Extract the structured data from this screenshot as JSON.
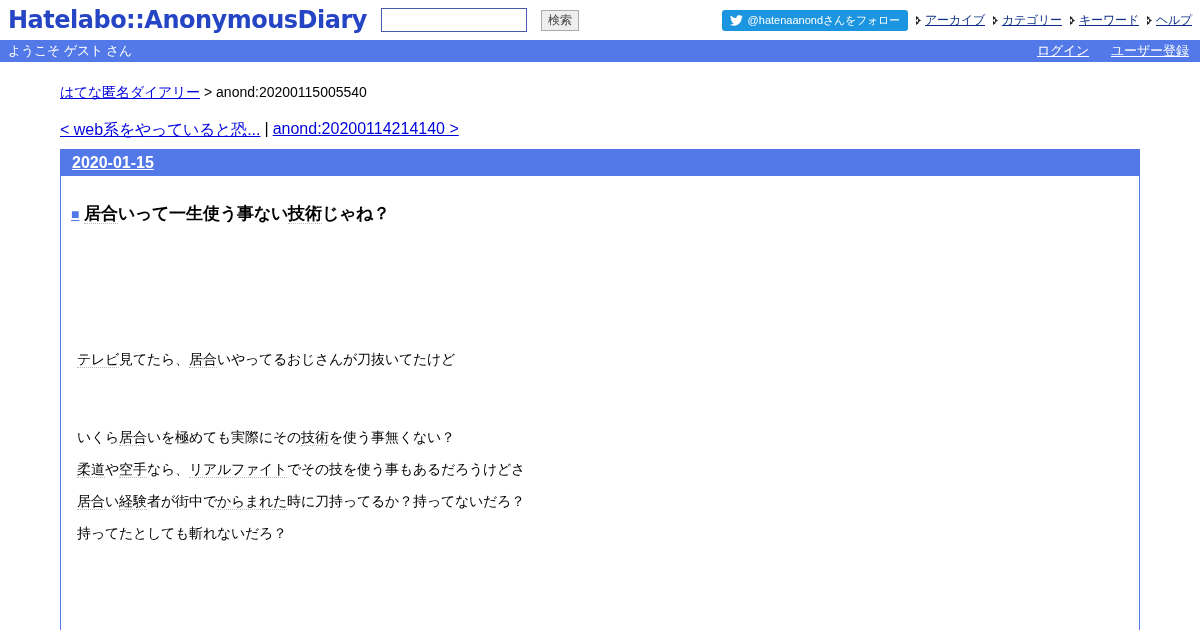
{
  "header": {
    "logo": "Hatelabo::AnonymousDiary",
    "search": {
      "button": "検索"
    },
    "follow_button": "@hatenaanondさんをフォロー",
    "nav_links": [
      "アーカイブ",
      "カテゴリー",
      "キーワード",
      "ヘルプ"
    ]
  },
  "user_bar": {
    "welcome": "ようこそ ゲスト さん",
    "links": [
      "ログイン",
      "ユーザー登録"
    ]
  },
  "breadcrumb": {
    "link": "はてな匿名ダイアリー",
    "current": "> anond:20200115005540"
  },
  "pager": {
    "prev": "< web系をやっていると恐...",
    "separator": "|",
    "next": "anond:20200114214140 >"
  },
  "section": {
    "date": "2020-01-15",
    "title_mark": "■",
    "title": [
      {
        "text": "居合",
        "keyword": true
      },
      {
        "text": "いって一生使う事ない",
        "keyword": false
      },
      {
        "text": "技術",
        "keyword": true
      },
      {
        "text": "じゃね？",
        "keyword": false
      }
    ],
    "paragraphs": [
      {
        "parts": [
          {
            "text": "テレビ",
            "keyword": true
          },
          {
            "text": "見てたら、",
            "keyword": false
          },
          {
            "text": "居合",
            "keyword": true
          },
          {
            "text": "いやってるおじさんが刀抜いてたけど",
            "keyword": false
          }
        ]
      },
      {
        "parts": [
          {
            "text": "いくら",
            "keyword": false
          },
          {
            "text": "居合",
            "keyword": true
          },
          {
            "text": "いを極めても実際にその",
            "keyword": false
          },
          {
            "text": "技術",
            "keyword": true
          },
          {
            "text": "を使う事無くない？",
            "keyword": false
          }
        ]
      },
      {
        "parts": [
          {
            "text": "柔道",
            "keyword": true
          },
          {
            "text": "や",
            "keyword": false
          },
          {
            "text": "空手",
            "keyword": true
          },
          {
            "text": "なら、",
            "keyword": false
          },
          {
            "text": "リアルファイト",
            "keyword": true
          },
          {
            "text": "でその技を使う事もあるだろうけどさ",
            "keyword": false
          }
        ]
      },
      {
        "parts": [
          {
            "text": "居合",
            "keyword": true
          },
          {
            "text": "い",
            "keyword": false
          },
          {
            "text": "経験",
            "keyword": true
          },
          {
            "text": "者が街中で",
            "keyword": false
          },
          {
            "text": "からまれた",
            "keyword": true
          },
          {
            "text": "時に刀持ってるか？持ってないだろ？",
            "keyword": false
          }
        ]
      },
      {
        "parts": [
          {
            "text": "持ってたとしても斬れないだろ？",
            "keyword": false
          }
        ]
      }
    ]
  }
}
